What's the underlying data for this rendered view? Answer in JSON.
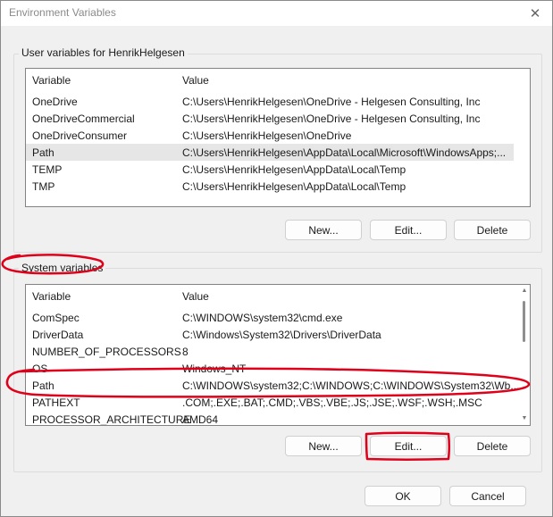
{
  "window": {
    "title": "Environment Variables",
    "close_icon": "close-icon"
  },
  "user_group": {
    "label": "User variables for HenrikHelgesen",
    "columns": {
      "variable": "Variable",
      "value": "Value"
    },
    "rows": [
      {
        "variable": "OneDrive",
        "value": "C:\\Users\\HenrikHelgesen\\OneDrive - Helgesen Consulting, Inc"
      },
      {
        "variable": "OneDriveCommercial",
        "value": "C:\\Users\\HenrikHelgesen\\OneDrive - Helgesen Consulting, Inc"
      },
      {
        "variable": "OneDriveConsumer",
        "value": "C:\\Users\\HenrikHelgesen\\OneDrive"
      },
      {
        "variable": "Path",
        "value": "C:\\Users\\HenrikHelgesen\\AppData\\Local\\Microsoft\\WindowsApps;..."
      },
      {
        "variable": "TEMP",
        "value": "C:\\Users\\HenrikHelgesen\\AppData\\Local\\Temp"
      },
      {
        "variable": "TMP",
        "value": "C:\\Users\\HenrikHelgesen\\AppData\\Local\\Temp"
      }
    ],
    "buttons": {
      "new": "New...",
      "edit": "Edit...",
      "delete": "Delete"
    }
  },
  "system_group": {
    "label": "System variables",
    "columns": {
      "variable": "Variable",
      "value": "Value"
    },
    "rows": [
      {
        "variable": "ComSpec",
        "value": "C:\\WINDOWS\\system32\\cmd.exe"
      },
      {
        "variable": "DriverData",
        "value": "C:\\Windows\\System32\\Drivers\\DriverData"
      },
      {
        "variable": "NUMBER_OF_PROCESSORS",
        "value": "8"
      },
      {
        "variable": "OS",
        "value": "Windows_NT"
      },
      {
        "variable": "Path",
        "value": "C:\\WINDOWS\\system32;C:\\WINDOWS;C:\\WINDOWS\\System32\\Wb..."
      },
      {
        "variable": "PATHEXT",
        "value": ".COM;.EXE;.BAT;.CMD;.VBS;.VBE;.JS;.JSE;.WSF;.WSH;.MSC"
      },
      {
        "variable": "PROCESSOR_ARCHITECTURE",
        "value": "AMD64"
      }
    ],
    "buttons": {
      "new": "New...",
      "edit": "Edit...",
      "delete": "Delete"
    }
  },
  "footer": {
    "ok": "OK",
    "cancel": "Cancel"
  },
  "annotation_color": "#e0001a"
}
